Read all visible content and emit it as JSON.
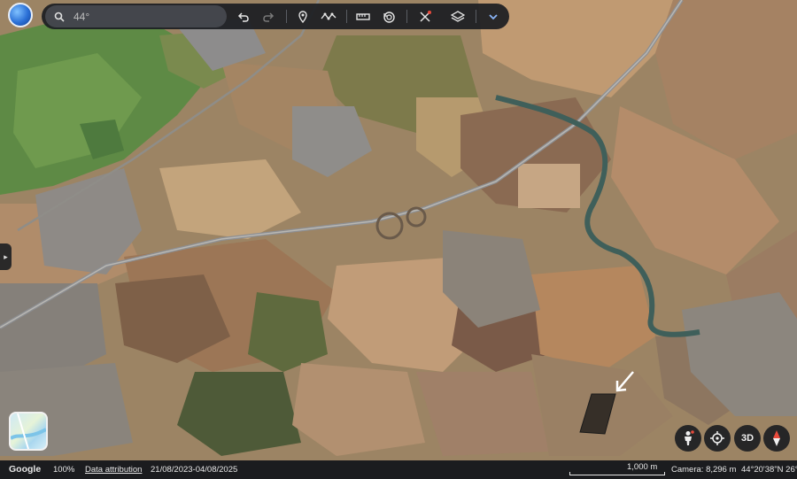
{
  "search": {
    "placeholder": "44°"
  },
  "toolbar": {
    "undo_icon": "undo-icon",
    "redo_icon": "redo-icon",
    "placemark_icon": "placemark-icon",
    "path_icon": "path-icon",
    "ruler_icon": "ruler-icon",
    "history_icon": "history-icon",
    "voyager_icon": "voyager-icon",
    "layers_icon": "layers-icon",
    "expand_icon": "chevron-down-icon"
  },
  "controls": {
    "pegman_icon": "pegman-icon",
    "locate_icon": "my-location-icon",
    "mode_3d": "3D",
    "compass_icon": "compass-icon"
  },
  "status": {
    "brand": "Google",
    "zoom": "100%",
    "attribution": "Data attribution",
    "dates": "21/08/2023-04/08/2025",
    "scale": "1,000 m",
    "camera": "Camera: 8,296 m",
    "coords": "44°20'38\"N 26°"
  },
  "colors": {
    "toolbar_bg": "#1c1e22",
    "field_tan": "#b69a72",
    "field_green": "#5f8a4a",
    "river": "#3f5f5a",
    "road": "#8d8f93",
    "marker": "#ffffff"
  }
}
